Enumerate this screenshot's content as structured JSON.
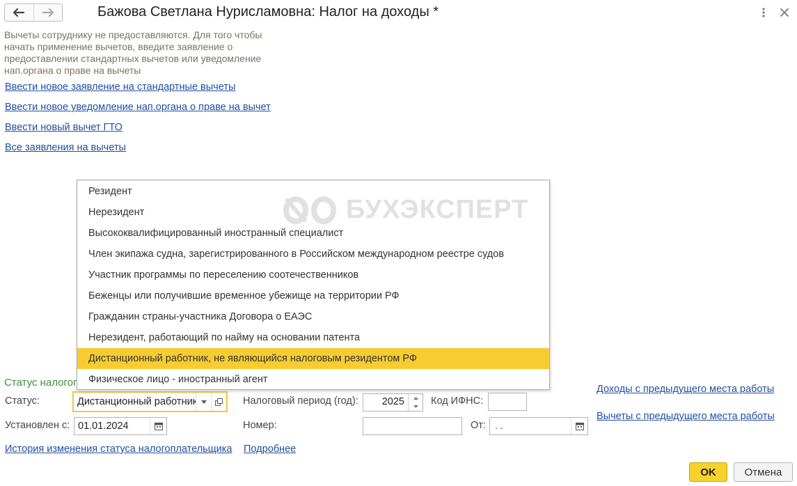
{
  "window": {
    "title": "Бажова Светлана Нурисламовна: Налог на доходы *"
  },
  "info": {
    "message": "Вычеты сотруднику не предоставляются. Для того чтобы начать применение вычетов, введите заявление о предоставлении стандартных вычетов или уведомление нап.органа о праве на вычеты"
  },
  "links": {
    "new_standard": "Ввести новое заявление на стандартные вычеты",
    "new_notice": "Ввести новое уведомление нап.органа о праве на вычет",
    "new_gto": "Ввести новый вычет ГТО",
    "all_statements": "Все заявления на вычеты",
    "status_history": "История изменения статуса налогоплательщика",
    "more": "Подробнее",
    "prev_income": "Доходы с предыдущего места работы",
    "prev_deductions": "Вычеты с предыдущего места работы"
  },
  "dropdown": {
    "items": [
      "Резидент",
      "Нерезидент",
      "Высококвалифицированный иностранный специалист",
      "Член экипажа судна, зарегистрированного в Российском международном реестре судов",
      "Участник программы по переселению соотечественников",
      "Беженцы или получившие временное убежище на территории РФ",
      "Гражданин страны-участника Договора о ЕАЭС",
      "Нерезидент, работающий по найму на основании патента",
      "Дистанционный работник, не являющийся налоговым резидентом РФ",
      "Физическое лицо - иностранный агент"
    ],
    "selected_index": 8
  },
  "watermark": {
    "text": "БУХЭКСПЕРТ"
  },
  "status_section": {
    "title": "Статус налогоплательщика",
    "status_label": "Статус:",
    "status_value": "Дистанционный работник",
    "established_label": "Установлен с:",
    "established_value": "01.01.2024",
    "period_label": "Налоговый период (год):",
    "period_value": "2025",
    "ifns_label": "Код ИФНС:",
    "ifns_value": "",
    "number_label": "Номер:",
    "number_value": "",
    "from_label": "От:",
    "from_value": " .  ."
  },
  "buttons": {
    "ok": "OK",
    "cancel": "Отмена"
  },
  "colors": {
    "link": "#1f4ea3",
    "section_title": "#3c8f3c",
    "selected_item": "#f7cc32",
    "primary_button": "#f7d22d",
    "info_text": "#7a7262"
  }
}
